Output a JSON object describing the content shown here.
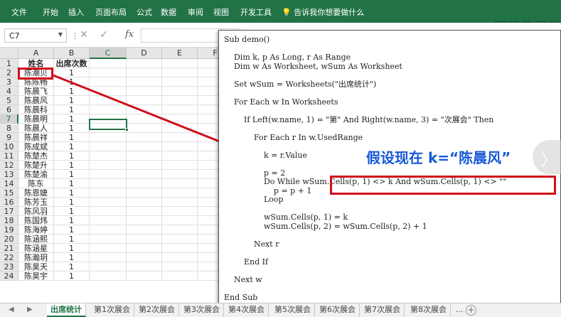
{
  "ribbon": {
    "tabs": [
      "文件",
      "开始",
      "插入",
      "页面布局",
      "公式",
      "数据",
      "审阅",
      "视图",
      "开发工具"
    ],
    "tell_me": "告诉我你想要做什么",
    "watermark": "网易云课堂"
  },
  "formula_bar": {
    "name_box": "C7",
    "fx": "fx"
  },
  "grid": {
    "columns": [
      "A",
      "B",
      "C",
      "D",
      "E",
      "F"
    ],
    "selected_column": "C",
    "selected_cell": "C7",
    "rows": [
      {
        "n": "1",
        "a": "姓名",
        "b": "出席次数"
      },
      {
        "n": "2",
        "a": "陈潮贝",
        "b": "1"
      },
      {
        "n": "3",
        "a": "陈陈畅",
        "b": "1"
      },
      {
        "n": "4",
        "a": "陈晨飞",
        "b": "1"
      },
      {
        "n": "5",
        "a": "陈晨风",
        "b": "1"
      },
      {
        "n": "6",
        "a": "陈晨科",
        "b": "1"
      },
      {
        "n": "7",
        "a": "陈晨明",
        "b": "1"
      },
      {
        "n": "8",
        "a": "陈晨人",
        "b": "1"
      },
      {
        "n": "9",
        "a": "陈晨祥",
        "b": "1"
      },
      {
        "n": "10",
        "a": "陈成斌",
        "b": "1"
      },
      {
        "n": "11",
        "a": "陈楚杰",
        "b": "1"
      },
      {
        "n": "12",
        "a": "陈楚升",
        "b": "1"
      },
      {
        "n": "13",
        "a": "陈楚渝",
        "b": "1"
      },
      {
        "n": "14",
        "a": "陈东",
        "b": "1"
      },
      {
        "n": "15",
        "a": "陈恩婕",
        "b": "1"
      },
      {
        "n": "16",
        "a": "陈芳玉",
        "b": "1"
      },
      {
        "n": "17",
        "a": "陈风羽",
        "b": "1"
      },
      {
        "n": "18",
        "a": "陈国炜",
        "b": "1"
      },
      {
        "n": "19",
        "a": "陈海婷",
        "b": "1"
      },
      {
        "n": "20",
        "a": "陈涵熙",
        "b": "1"
      },
      {
        "n": "21",
        "a": "陈涵星",
        "b": "1"
      },
      {
        "n": "22",
        "a": "陈瀚玥",
        "b": "1"
      },
      {
        "n": "23",
        "a": "陈昊天",
        "b": "1"
      },
      {
        "n": "24",
        "a": "陈昊宇",
        "b": "1"
      }
    ]
  },
  "code_window": {
    "lines": [
      "Sub demo()",
      "",
      "    Dim k, p As Long, r As Range",
      "    Dim w As Worksheet, wSum As Worksheet",
      "",
      "    Set wSum = Worksheets(\"出席统计\")",
      "",
      "    For Each w In Worksheets",
      "",
      "        If Left(w.name, 1) = \"第\" And Right(w.name, 3) = \"次展会\" Then",
      "",
      "            For Each r In w.UsedRange",
      "",
      "                k = r.Value",
      "",
      "                p = 2",
      "                Do While wSum.Cells(p, 1) <> k And wSum.Cells(p, 1) <> \"\"",
      "                    p = p + 1",
      "                Loop",
      "",
      "                wSum.Cells(p, 1) = k",
      "                wSum.Cells(p, 2) = wSum.Cells(p, 2) + 1",
      "",
      "            Next r",
      "",
      "        End If",
      "",
      "    Next w",
      "",
      "End Sub"
    ],
    "annotation": "假设现在 k=“陈晨风”"
  },
  "sheet_tabs": {
    "tabs": [
      "出席统计",
      "第1次展会",
      "第2次展会",
      "第3次展会",
      "第4次展会",
      "第5次展会",
      "第6次展会",
      "第7次展会",
      "第8次展会"
    ],
    "active": "出席统计",
    "more": "...",
    "add": "+"
  },
  "colors": {
    "excel_green": "#217346",
    "highlight_red": "#d10f1b",
    "annotation_blue": "#1659d6"
  }
}
